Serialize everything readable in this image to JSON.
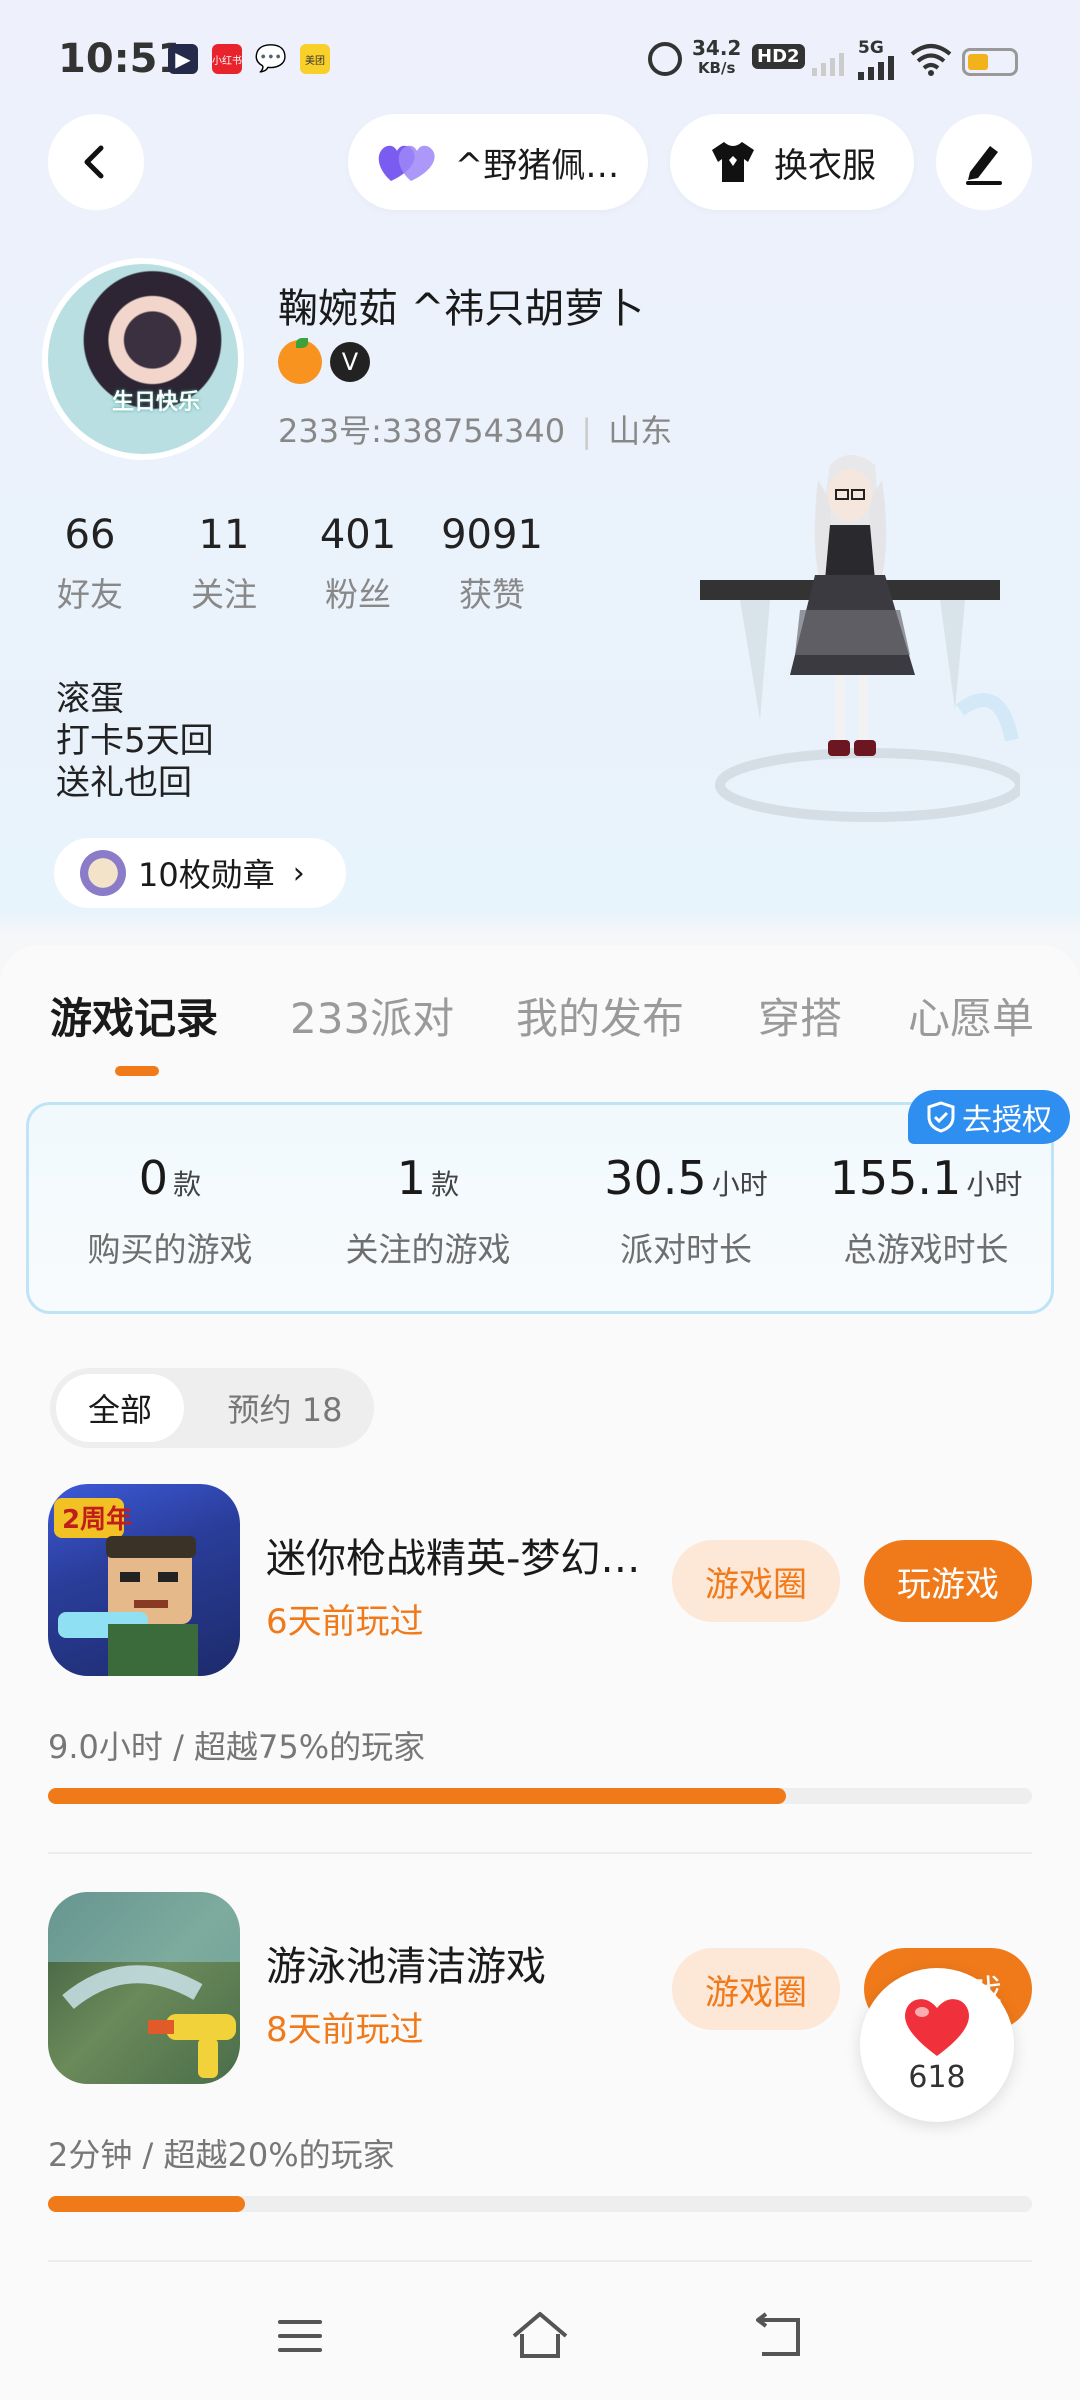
{
  "status_bar": {
    "time": "10:51",
    "net_speed_value": "34.2",
    "net_speed_unit": "KB/s",
    "hd_label": "HD2",
    "network_label": "5G",
    "notification_icons": [
      "media-app-icon",
      "xiaohongshu-icon",
      "wechat-icon",
      "meituan-icon"
    ],
    "app_icon_labels": [
      "小红书",
      "美团"
    ],
    "battery_percent": 35
  },
  "header": {
    "group_label": "^野猪佩…",
    "outfit_label": "换衣服"
  },
  "profile": {
    "avatar_text": "生日快乐",
    "name": "鞠婉茹  ^祎只胡萝卜",
    "v_badge": "V",
    "id_line": "233号:338754340",
    "region": "山东",
    "stats": [
      {
        "value": "66",
        "label": "好友"
      },
      {
        "value": "11",
        "label": "关注"
      },
      {
        "value": "401",
        "label": "粉丝"
      },
      {
        "value": "9091",
        "label": "获赞"
      }
    ],
    "bio_lines": [
      "滚蛋",
      "打卡5天回",
      "送礼也回"
    ],
    "medal_label": "10枚勋章"
  },
  "tabs": [
    "游戏记录",
    "233派对",
    "我的发布",
    "穿搭",
    "心愿单"
  ],
  "summary": {
    "auth_label": "去授权",
    "items": [
      {
        "value": "0",
        "unit": "款",
        "label": "购买的游戏"
      },
      {
        "value": "1",
        "unit": "款",
        "label": "关注的游戏"
      },
      {
        "value": "30.5",
        "unit": "小时",
        "label": "派对时长"
      },
      {
        "value": "155.1",
        "unit": "小时",
        "label": "总游戏时长"
      }
    ]
  },
  "filter": {
    "all": "全部",
    "reserve": "预约 18"
  },
  "games": [
    {
      "icon_text": "2周年",
      "title": "迷你枪战精英-梦幻…",
      "last_played": "6天前玩过",
      "circle_label": "游戏圈",
      "play_label": "玩游戏",
      "progress_text": "9.0小时 / 超越75%的玩家",
      "progress": 0.75
    },
    {
      "icon_text": "",
      "title": "游泳池清洁游戏",
      "last_played": "8天前玩过",
      "circle_label": "游戏圈",
      "play_label": "戏",
      "progress_text": "2分钟 / 超越20%的玩家",
      "progress": 0.2
    }
  ],
  "likes": {
    "count": "618"
  },
  "colors": {
    "accent": "#f07a1a",
    "auth_blue": "#2f8ff0",
    "heart": "#f0303a"
  }
}
